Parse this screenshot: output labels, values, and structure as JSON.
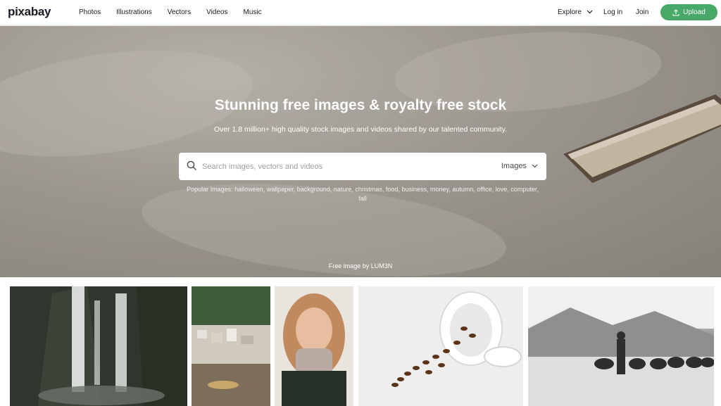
{
  "brand": {
    "logo": "pixabay"
  },
  "nav": {
    "items": [
      "Photos",
      "Illustrations",
      "Vectors",
      "Videos",
      "Music"
    ]
  },
  "header_right": {
    "explore": "Explore",
    "login": "Log in",
    "join": "Join",
    "upload": "Upload"
  },
  "hero": {
    "title": "Stunning free images & royalty free stock",
    "subtitle": "Over 1.8 million+ high quality stock images and videos shared by our talented community.",
    "search": {
      "placeholder": "Search images, vectors and videos",
      "value": "",
      "type": "Images"
    },
    "popular": {
      "prefix": "Popular Images:",
      "terms": [
        "halloween",
        "wallpaper",
        "background",
        "nature",
        "christmas",
        "food",
        "business",
        "money",
        "autumn",
        "office",
        "love",
        "computer",
        "fall"
      ]
    },
    "credit": {
      "prefix": "Free image by",
      "author": "LUM3N"
    }
  },
  "gallery": {
    "photos": [
      "waterfall",
      "coastal-village",
      "woman-in-scarf",
      "coffee-beans-cup",
      "buffalo-herder-beach"
    ]
  },
  "colors": {
    "accent": "#48a868",
    "text": "#191b26"
  },
  "icons": {
    "search": "search-icon",
    "chevron": "chevron-down-icon",
    "upload": "upload-icon"
  }
}
